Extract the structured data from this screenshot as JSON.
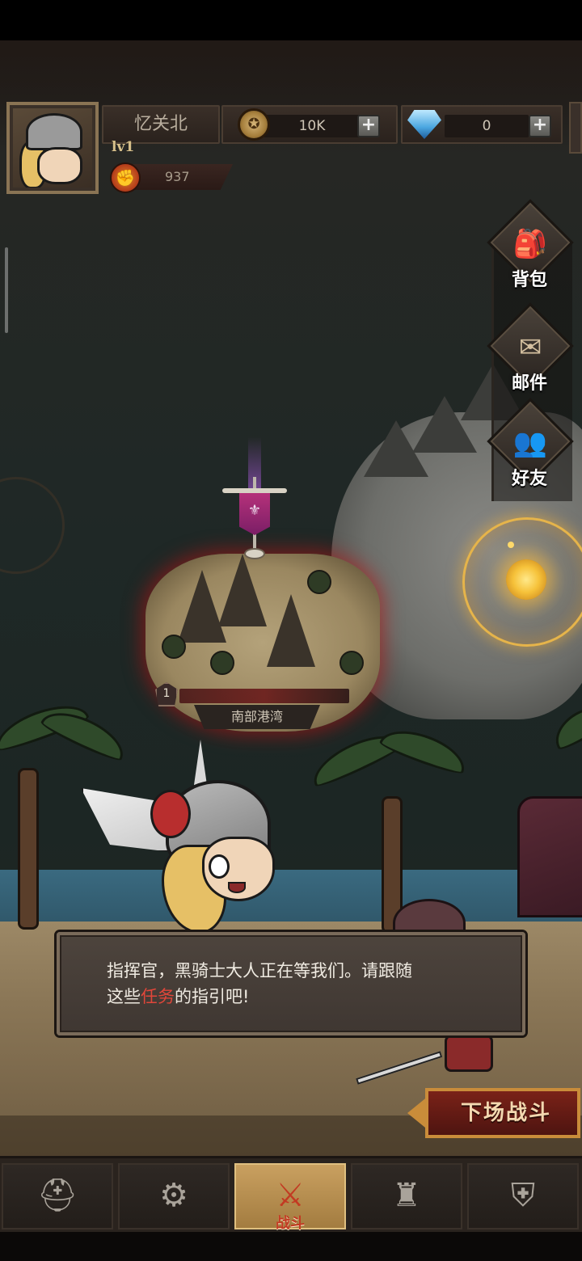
{
  "player": {
    "name": "忆关北",
    "level": "lv1",
    "power": "937"
  },
  "resources": {
    "coins": "10K",
    "gems": "0"
  },
  "side_menu": [
    {
      "label": "背包",
      "icon": "backpack-icon"
    },
    {
      "label": "邮件",
      "icon": "mail-envelope-icon"
    },
    {
      "label": "好友",
      "icon": "friends-icon"
    }
  ],
  "map": {
    "stage_number": "1",
    "stage_name": "南部港湾"
  },
  "dialog": {
    "line1": "指挥官，黑骑士大人正在等我们。请跟随",
    "line2_before": "这些",
    "line2_highlight": "任务",
    "line2_after": "的指引吧!",
    "highlight_color": "#e0463a"
  },
  "battle_button": {
    "label": "下场战斗"
  },
  "tabs": [
    {
      "icon": "hero-helmet-icon",
      "label": ""
    },
    {
      "icon": "gear-map-icon",
      "label": ""
    },
    {
      "icon": "crossed-swords-icon",
      "label": "战斗",
      "active": true
    },
    {
      "icon": "castle-tower-icon",
      "label": ""
    },
    {
      "icon": "guild-shield-icon",
      "label": ""
    }
  ]
}
